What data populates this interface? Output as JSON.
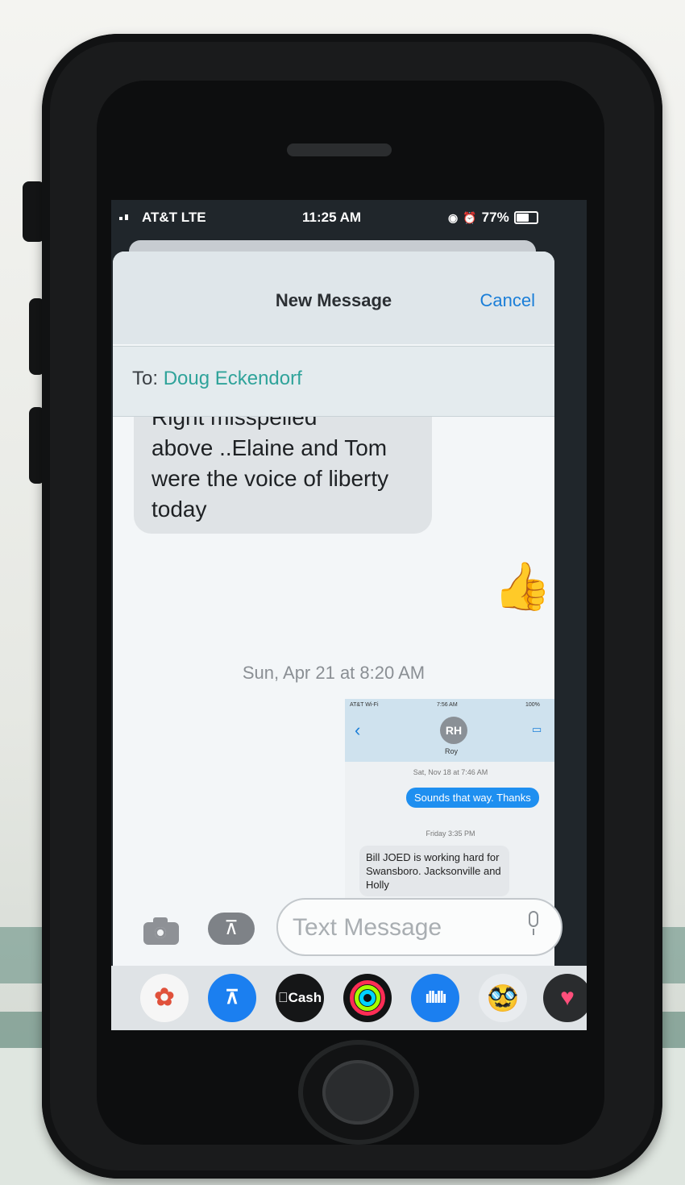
{
  "status_bar": {
    "carrier": "AT&T  LTE",
    "time": "11:25 AM",
    "battery": "77%",
    "battery_level": 0.77
  },
  "compose_sheet": {
    "title": "New Message",
    "cancel_label": "Cancel",
    "to_label": "To:",
    "recipient": "Doug Eckendorf"
  },
  "conversation": {
    "incoming_lines": [
      "Right misspelled",
      "above ..Elaine and Tom",
      "were the voice of liberty",
      "today"
    ],
    "reaction": "👍",
    "timestamp": "Sun, Apr 21 at 8:20 AM"
  },
  "attachment_screenshot": {
    "status_left": "AT&T Wi-Fi",
    "status_time": "7:56 AM",
    "status_right": "100%",
    "avatar_initials": "RH",
    "contact_name": "Roy",
    "timestamp_1": "Sat, Nov 18 at 7:46 AM",
    "outgoing": "Sounds that way. Thanks",
    "timestamp_2": "Friday 3:35 PM",
    "incoming": "Bill JOED is working hard for Swansboro. Jacksonville and Holly"
  },
  "input": {
    "placeholder": "Text Message"
  },
  "app_drawer": {
    "cash_label": "Cash",
    "apps": [
      "photos-icon",
      "app-store-icon",
      "cash-app-icon",
      "fitness-icon",
      "voice-memo-icon",
      "memoji-icon",
      "heart-icon"
    ]
  },
  "colors": {
    "accent_blue": "#1a7ed8",
    "recipient_teal": "#2fa39a",
    "bubble_grey": "#dfe3e6",
    "case_black": "#1a1b1c"
  }
}
